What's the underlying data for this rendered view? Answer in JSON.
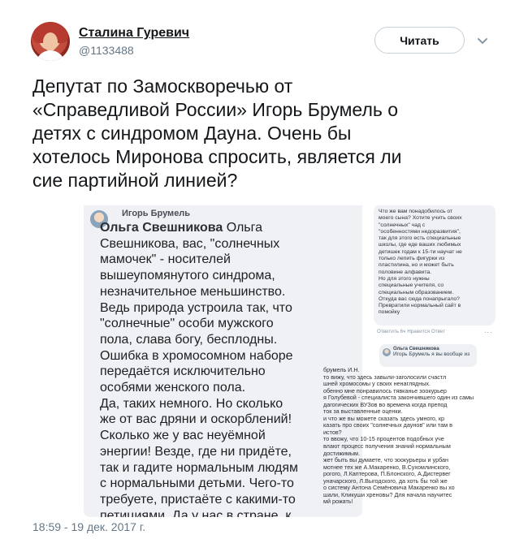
{
  "author": {
    "name": "Сталина Гуревич",
    "handle": "@1133488"
  },
  "actions": {
    "follow_label": "Читать"
  },
  "tweet": {
    "text": "Депутат по Замоскворечью от\n«Справедливой России» Игорь Брумель о\nдетях с синдромом Дауна. Очень бы\nхотелось Миронова спросить, является ли\nсие партийной линией?",
    "timestamp": "18:59 - 19 дек. 2017 г."
  },
  "screenshot_left": {
    "author": "Игорь Брумель",
    "lead": "Ольга Свешникова",
    "body": " Ольга\nСвешникова, вас, \"солнечных\nмамочек\" - носителей\nвышеупомянутого синдрома,\nнезначительное меньшинство.\nВедь природа устроила так, что\n\"солнечные\" особи мужского\nпола, слава богу, бесплодны.\nОшибка в хромосомном наборе\nпередаётся исключительно\nособями женского пола.\nДа, таких немного. Но сколько\nже от вас дряни и оскорблений!\nСколько же у вас неуёмной\nэнергии! Везде, где ни придёте,\nтак и гадите нормальным людям\nс нормальными детьми. Чего-то\nтребуете, пристаёте с какими-то\nпетициями.  Да у нас в стране, к"
  },
  "screenshot_right": {
    "top_bubble": "Что же вам понадобилось от\nмоего сына? Хотите учить своих\n\"солнечных\" чад с\n\"особенностями недоразвития\",\nтак для этого есть специальные\nшколы, где еде ваших любимых\nдетишек годам к 15-ти научат не\nтолько лепить фигурки из\nпластилина, но и может быть\nполовине алфавита.\nНо для этого нужны\nспециальные учителя, со\nспециальным образованием.\nОткуда вас сюда понапрыгало?\nПревратили нормальный сайт в\nпомойку",
    "meta": "Ответить   6ч    Нравится   Ответ",
    "dots": "...",
    "reply_author": "Ольга Свешникова",
    "reply_quote": "Игорь Брумель  я вы вообще из",
    "body": "брумель И.Н.\n то вижу, что здесь завыли-заголосили счастл\nшней хромосомы у своих ненаглядных.\nобенно мне понравилось тявканье зоокурьер\nя Голубевой - специалиста закончившего один из самы\nдагогических ВУЗов во времена когда препод\nток за выставленные оценки.\nи что же вы можете сказать здесь умного, кр\nказать про своих \"солнечных даунов\" или там в\nистов?\nто ввожу, что 10-15 процентов подобных уче\nвлают процесс получения знаний нормальным\nдостижимым.\nжет быть вы думаете, что зоокурьеры и урбан\nмотнее тех же А.Макаренко, В.Сухомлинского,\nрогого, Л.Каптерова, П.Блонского, А.Дистервег\nуначарского, Л.Выгодского, да хоть бы той же\nо систему Антона Семёновича Макаренко вы хо\nшали, Кликуши хреновы? Для начала научитес\nмй рожать!"
  }
}
